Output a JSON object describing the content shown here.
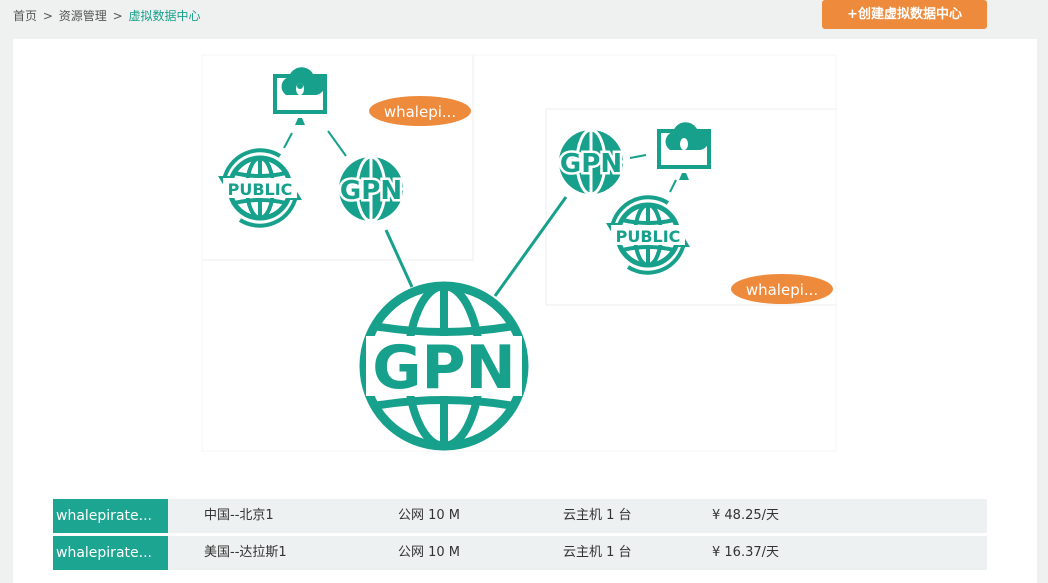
{
  "breadcrumb": {
    "home": "首页",
    "section": "资源管理",
    "current": "虚拟数据中心",
    "separator": ">"
  },
  "actions": {
    "create_label": "+创建虚拟数据中心"
  },
  "diagram": {
    "center_label": "GPN",
    "left_cluster": {
      "gpn_label": "GPN",
      "public_label": "PUBLIC",
      "badge": "whalepi..."
    },
    "right_cluster": {
      "gpn_label": "GPN",
      "public_label": "PUBLIC",
      "badge": "whalepi..."
    },
    "icons": [
      "globe-icon",
      "cloud-monitor-icon",
      "penguin-icon",
      "refresh-arrows-icon"
    ]
  },
  "datacenters": [
    {
      "name": "whalepirate...",
      "region": "中国--北京1",
      "bandwidth": "公网 10 M",
      "hosts": "云主机 1 台",
      "price": "¥ 48.25/天"
    },
    {
      "name": "whalepirate...",
      "region": "美国--达拉斯1",
      "bandwidth": "公网 10 M",
      "hosts": "云主机 1 台",
      "price": "¥ 16.37/天"
    }
  ],
  "colors": {
    "teal": "#17a08b",
    "orange": "#ee8a3c",
    "background": "#eff1f1"
  }
}
